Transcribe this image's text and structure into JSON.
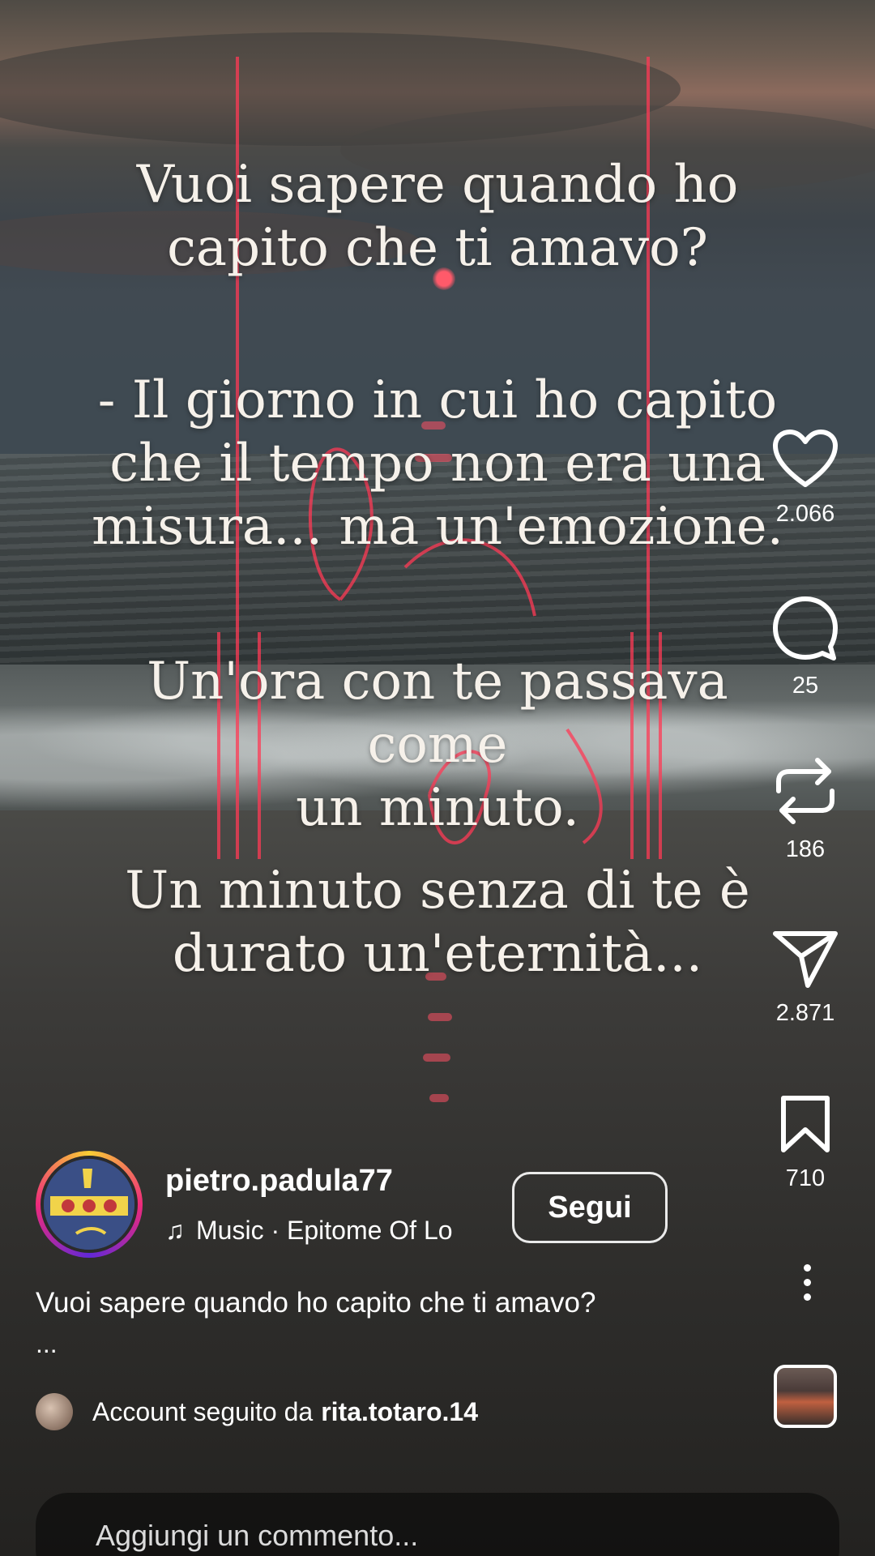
{
  "post": {
    "lyrics": [
      [
        "Vuoi sapere quando ho",
        "capito che ti amavo?"
      ],
      [
        "- Il giorno in cui ho capito",
        "che il tempo non era una",
        "misura... ma un'emozione."
      ],
      [
        "Un'ora con te passava come",
        "un minuto."
      ],
      [
        "Un minuto senza di te è",
        "durato un'eternità..."
      ]
    ]
  },
  "actions": {
    "likes": "2.066",
    "comments": "25",
    "reposts": "186",
    "shares": "2.871",
    "saves": "710"
  },
  "author": {
    "username": "pietro.padula77",
    "music": "Music · Epitome Of Lo",
    "music_note_icon": "music-note-icon",
    "follow_label": "Segui"
  },
  "caption": {
    "text": "Vuoi sapere quando ho capito che ti amavo?",
    "more": "..."
  },
  "social": {
    "followed_prefix": "Account seguito da",
    "followed_by": "rita.totaro.14"
  },
  "comment": {
    "placeholder": "Aggiungi un commento..."
  },
  "icons": {
    "like": "heart-icon",
    "comment": "comment-bubble-icon",
    "repost": "repost-icon",
    "share": "paper-plane-icon",
    "save": "bookmark-icon",
    "more": "more-vertical-icon"
  },
  "colors": {
    "neon": "#ff3a55",
    "story_ring_start": "#f9ce34",
    "story_ring_end": "#ee2a7b"
  }
}
